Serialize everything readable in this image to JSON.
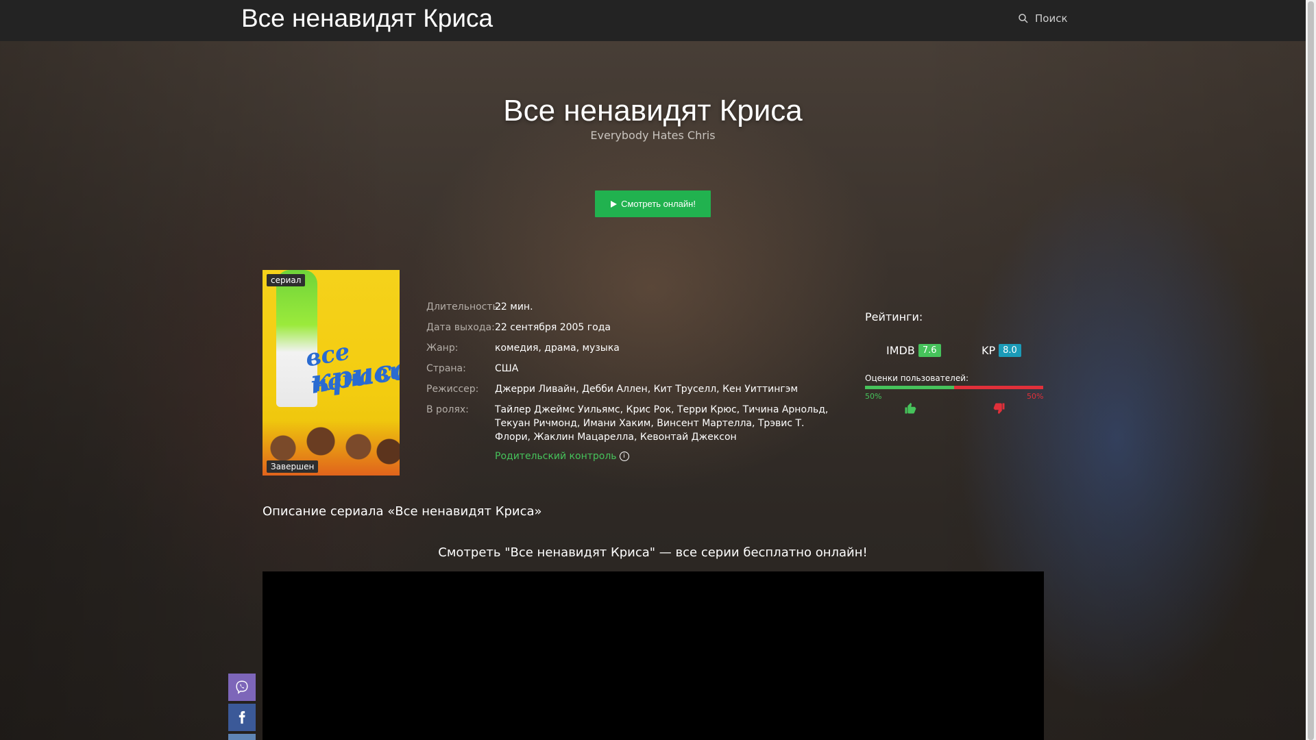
{
  "header": {
    "site_title": "Все ненавидят Криса",
    "search_label": "Поиск"
  },
  "hero": {
    "title": "Все ненавидят Криса",
    "subtitle": "Everybody Hates Chris",
    "watch_button": "Смотреть онлайн!"
  },
  "poster": {
    "type_badge": "сериал",
    "status_badge": "Завершен",
    "art_text_line1": "все ненавидят",
    "art_text_line2": "криса"
  },
  "details": [
    {
      "label": "Длительность:",
      "value": "22 мин."
    },
    {
      "label": "Дата выхода:",
      "value": "22 сентября 2005 года"
    },
    {
      "label": "Жанр:",
      "value": "комедия, драма, музыка"
    },
    {
      "label": "Страна:",
      "value": "США"
    },
    {
      "label": "Режиссер:",
      "value": "Джерри Ливайн, Дебби Аллен, Кит Труселл, Кен Уиттингэм"
    },
    {
      "label": "В ролях:",
      "value": "Тайлер Джеймс Уильямс, Крис Рок, Терри Крюс, Тичина Арнольд, Текуан Ричмонд, Имани Хаким, Винсент Мартелла, Трэвис Т. Флори, Жаклин Мацарелла, Кевонтай Джексон"
    }
  ],
  "parental_control": "Родительский контроль",
  "ratings": {
    "title": "Рейтинги:",
    "imdb": {
      "label": "IMDB",
      "score": "7.6",
      "color": "#46c35b"
    },
    "kp": {
      "label": "KP",
      "score": "8.0",
      "color": "#1b9bb8"
    },
    "users_label": "Оценки пользователей:",
    "like_percent": "50%",
    "dislike_percent": "50%",
    "like_fraction": 0.5
  },
  "description_title": "Описание сериала «Все ненавидят Криса»",
  "watch_heading": "Смотреть \"Все ненавидят Криса\" — все серии бесплатно онлайн!",
  "share": [
    "viber-icon",
    "facebook-icon",
    "vk-icon"
  ],
  "colors": {
    "accent_green": "#21b24f",
    "header_bg": "#232323"
  }
}
